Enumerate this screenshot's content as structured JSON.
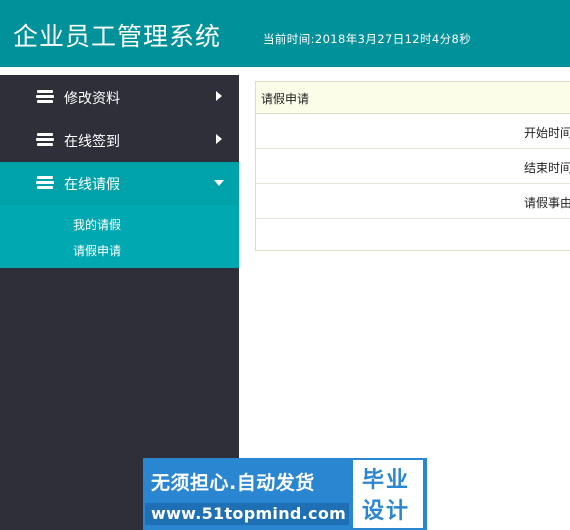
{
  "app": {
    "title": "企业员工管理系统",
    "clock": "当前时间:2018年3月27日12时4分8秒"
  },
  "sidebar": {
    "items": [
      {
        "label": "修改资料",
        "icon": "stack-icon",
        "arrow": "chevron-right-icon"
      },
      {
        "label": "在线签到",
        "icon": "stack-icon",
        "arrow": "chevron-right-icon"
      },
      {
        "label": "在线请假",
        "icon": "stack-icon",
        "arrow": "chevron-down-icon",
        "active": true
      }
    ],
    "submenu": [
      {
        "label": "我的请假"
      },
      {
        "label": "请假申请"
      }
    ]
  },
  "form": {
    "title": "请假申请",
    "fields": [
      {
        "label": "开始时间"
      },
      {
        "label": "结束时间"
      },
      {
        "label": "请假事由"
      }
    ]
  },
  "banner": {
    "slogan": "无须担心.自动发货",
    "url": "www.51topmind.com",
    "badge_line1": "毕业",
    "badge_line2": "设计"
  },
  "colors": {
    "header": "#00919a",
    "sidebar": "#2f2f3a",
    "active": "#00a2a9",
    "submenu": "#00a9b1",
    "panel_head": "#fbfde9",
    "banner": "#2a86d1"
  }
}
